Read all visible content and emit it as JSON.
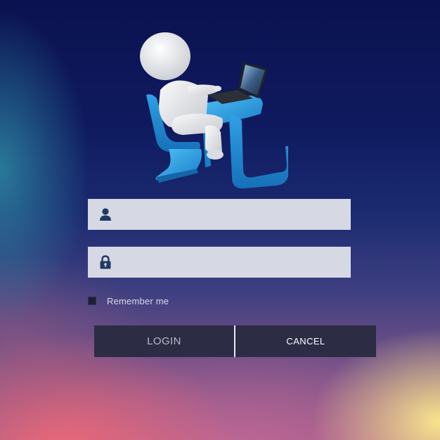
{
  "login_form": {
    "illustration": {
      "icon": "person-at-laptop-desk-illustration"
    },
    "username_field": {
      "icon": "user-icon",
      "value": "",
      "placeholder": ""
    },
    "password_field": {
      "icon": "lock-icon",
      "value": "",
      "placeholder": ""
    },
    "remember_me": {
      "label": "Remember me",
      "checked": false
    },
    "buttons": {
      "login_label": "LOGIN",
      "cancel_label": "CANCEL"
    },
    "colors": {
      "field_background": "#d6d8e4",
      "button_background": "#2d2c45",
      "icon_color": "#1f3a63",
      "desk_blue": "#2a9fe0"
    }
  }
}
